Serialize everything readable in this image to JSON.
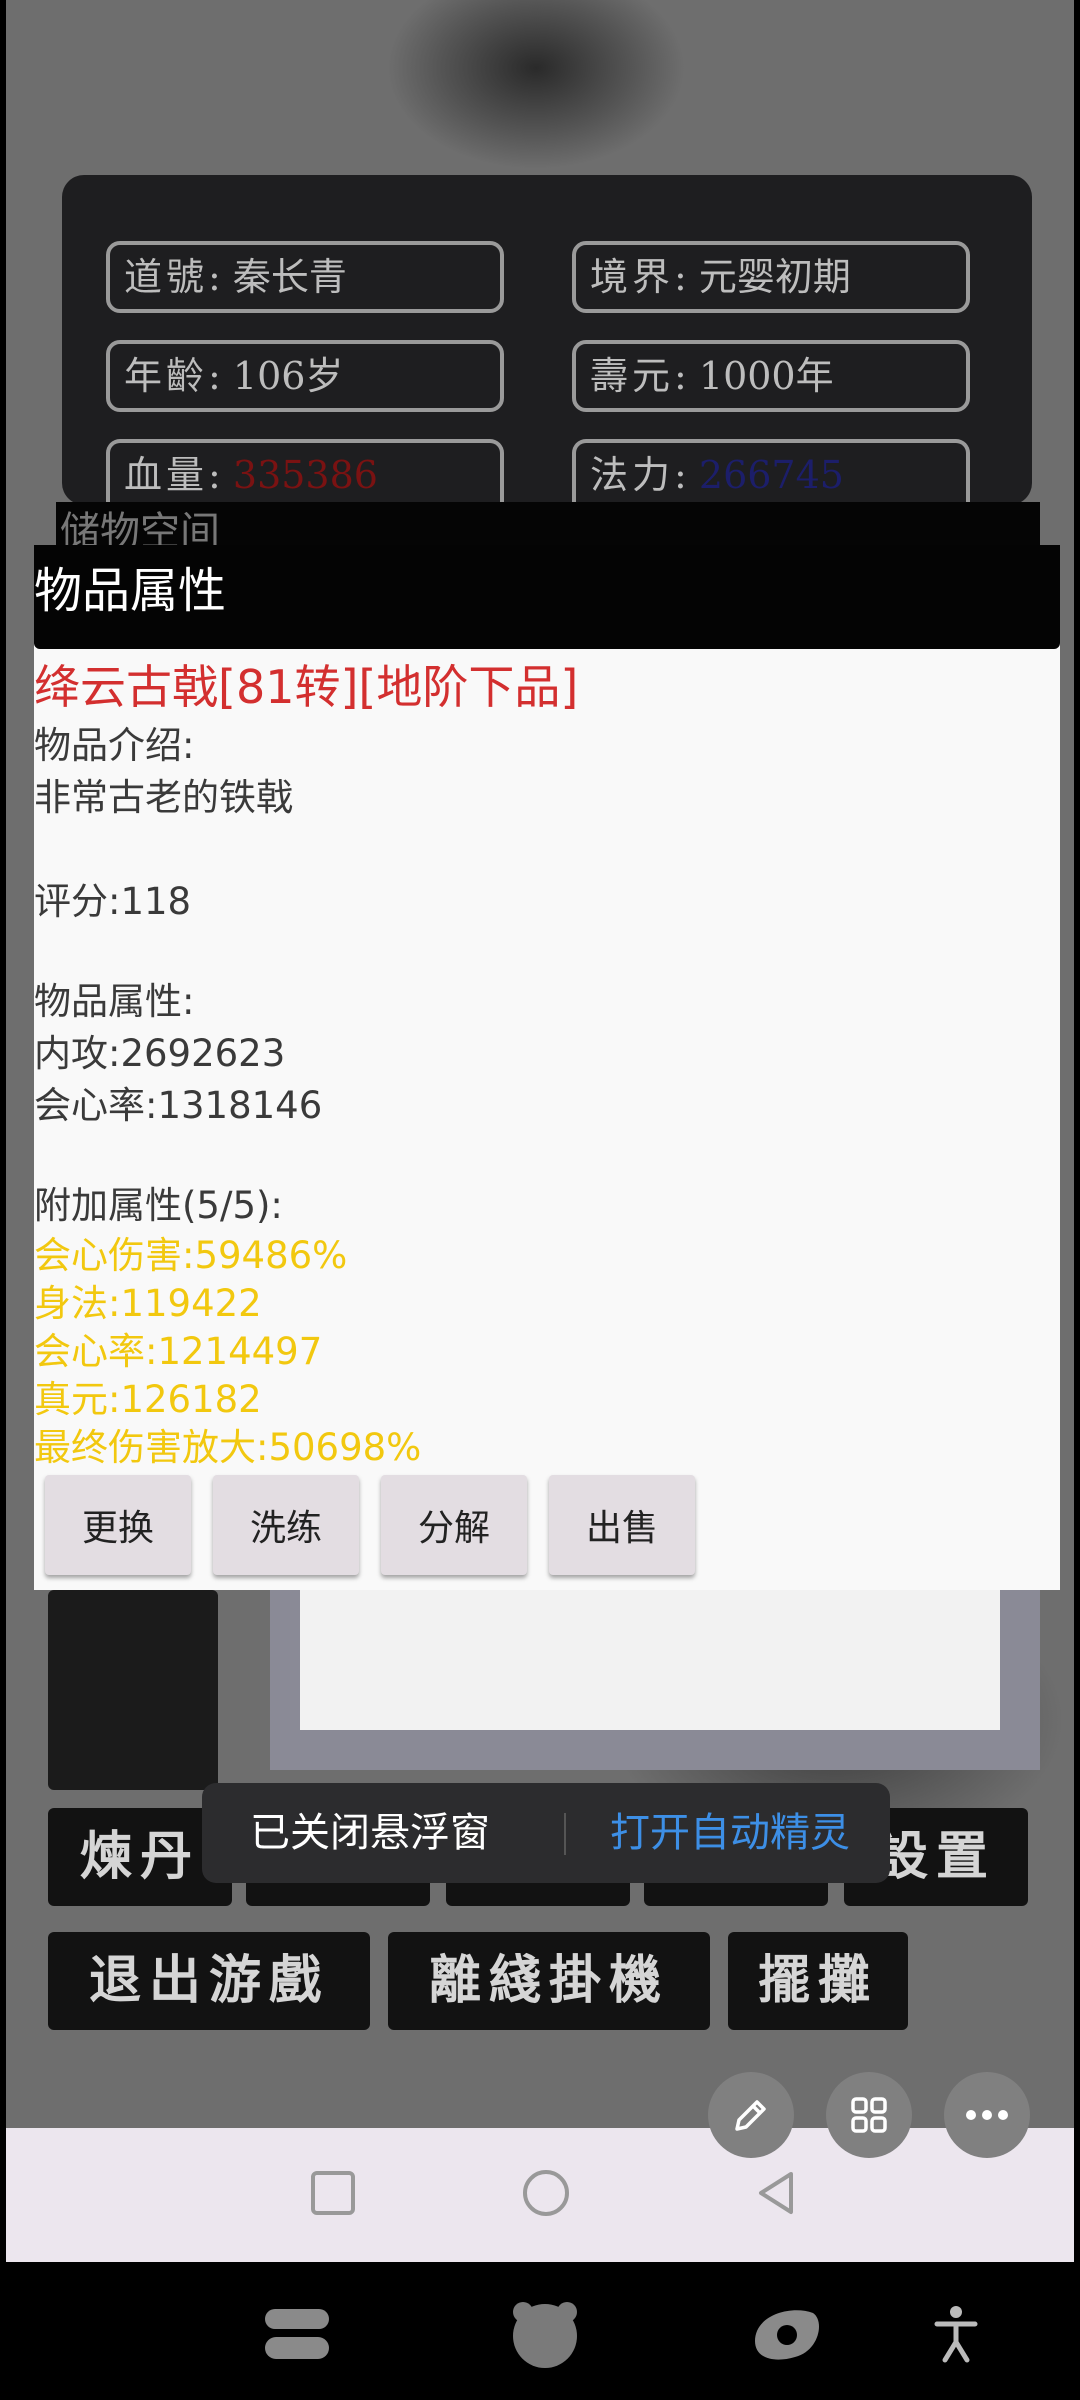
{
  "stats": {
    "name": {
      "label": "道號",
      "value": "秦长青"
    },
    "realm": {
      "label": "境界",
      "value": "元婴初期"
    },
    "age": {
      "label": "年齡",
      "value": "106岁"
    },
    "lifespan": {
      "label": "壽元",
      "value": "1000年"
    },
    "hp": {
      "label": "血量",
      "value": "335386"
    },
    "mp": {
      "label": "法力",
      "value": "266745"
    },
    "separator": ": "
  },
  "storage_title": "储物空间",
  "dialog": {
    "title": "物品属性",
    "item_name": "绛云古戟[81转][地阶下品]",
    "intro_label": "物品介绍:",
    "intro_text": "非常古老的铁戟",
    "score": "评分:118",
    "attr_label": "物品属性:",
    "attrs": [
      "内攻:2692623",
      "会心率:1318146"
    ],
    "extra_label": "附加属性(5/5):",
    "extra_attrs": [
      "会心伤害:59486%",
      "身法:119422",
      "会心率:1214497",
      "真元:126182",
      "最终伤害放大:50698%"
    ],
    "buttons": [
      "更换",
      "洗练",
      "分解",
      "出售"
    ]
  },
  "game_buttons": {
    "alchemy": "煉丹",
    "settings": "設置",
    "exit": "退出游戲",
    "offline": "離綫掛機",
    "stall": "擺攤"
  },
  "toast": {
    "message": "已关闭悬浮窗",
    "action": "打开自动精灵"
  },
  "colors": {
    "item_name": "#d32f2f",
    "extra_attrs": "#f2c80f",
    "hp": "#7a1212",
    "mp": "#1c1e6a",
    "toast_action": "#3d8fe6"
  },
  "icons": {
    "fab": [
      "pencil-icon",
      "grid-icon",
      "more-icon"
    ],
    "nav": [
      "recents-icon",
      "home-icon",
      "back-icon"
    ],
    "dock": [
      "app-icon-1",
      "app-icon-2",
      "app-icon-3",
      "accessibility-icon"
    ]
  }
}
